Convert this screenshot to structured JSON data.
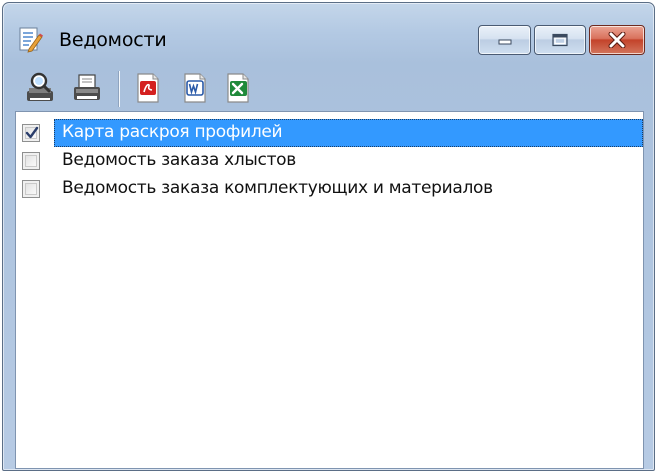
{
  "window": {
    "title": "Ведомости",
    "app_icon": "report-list-icon"
  },
  "caption_buttons": {
    "minimize_icon": "minimize-icon",
    "maximize_icon": "maximize-icon",
    "close_icon": "close-icon",
    "close_color": "#c3432a"
  },
  "toolbar": {
    "buttons": [
      {
        "icon": "print-preview-icon"
      },
      {
        "icon": "printer-icon"
      },
      {
        "icon": "pdf-export-icon",
        "color": "#d42020"
      },
      {
        "icon": "word-export-icon",
        "color": "#2a5aa8"
      },
      {
        "icon": "excel-export-icon",
        "color": "#1f8a3a"
      }
    ]
  },
  "list": {
    "items": [
      {
        "label": "Карта раскроя профилей",
        "checked": true,
        "selected": true
      },
      {
        "label": "Ведомость заказа хлыстов",
        "checked": false,
        "selected": false
      },
      {
        "label": "Ведомость заказа комплектующих и материалов",
        "checked": false,
        "selected": false
      }
    ],
    "selection_color": "#3399ff"
  }
}
